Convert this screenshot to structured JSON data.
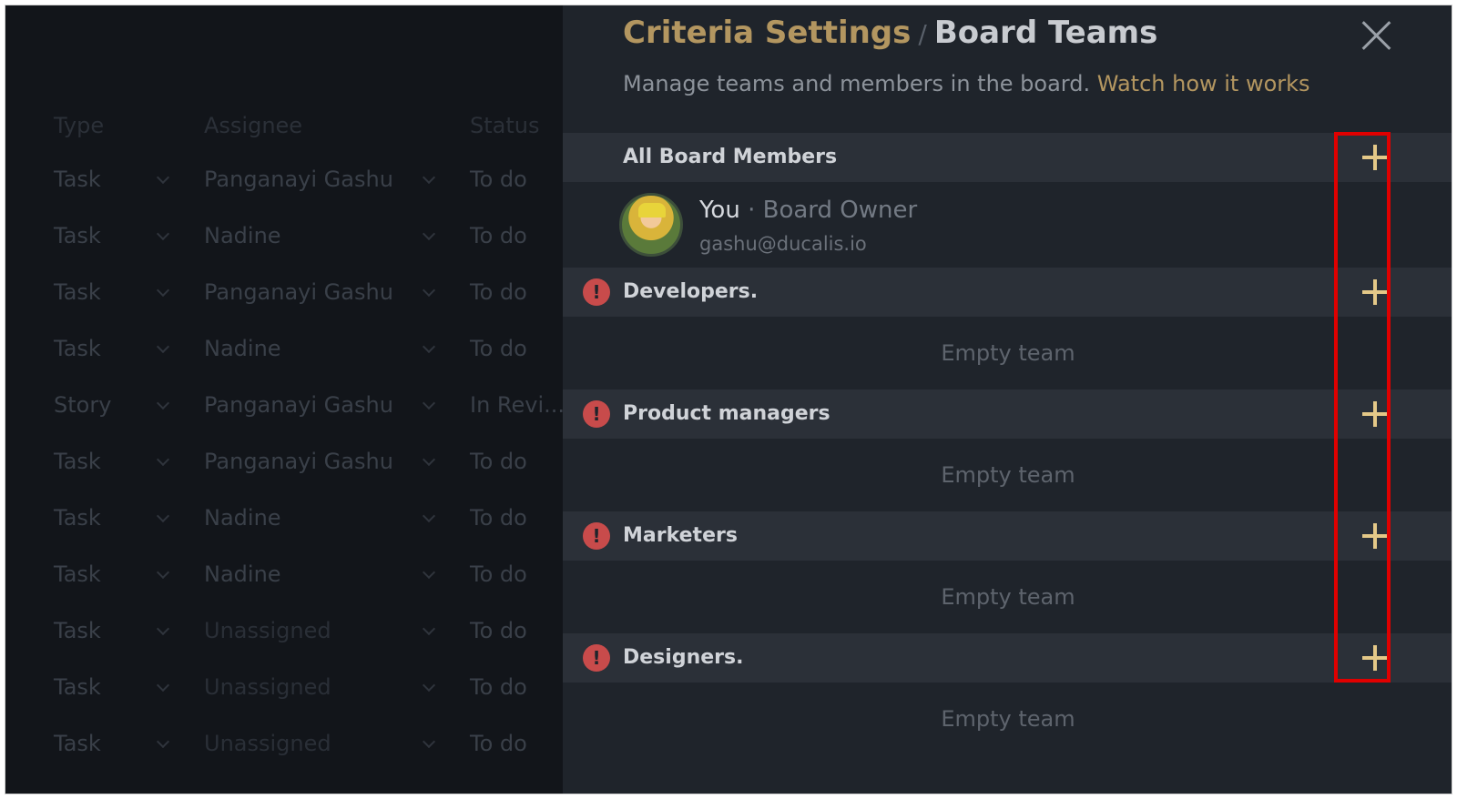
{
  "table": {
    "headers": [
      "Type",
      "Assignee",
      "Status"
    ],
    "rows": [
      {
        "type": "Task",
        "assignee": "Panganayi Gashu",
        "status": "To do"
      },
      {
        "type": "Task",
        "assignee": "Nadine",
        "status": "To do"
      },
      {
        "type": "Task",
        "assignee": "Panganayi Gashu",
        "status": "To do"
      },
      {
        "type": "Task",
        "assignee": "Nadine",
        "status": "To do"
      },
      {
        "type": "Story",
        "assignee": "Panganayi Gashu",
        "status": "In Revi..."
      },
      {
        "type": "Task",
        "assignee": "Panganayi Gashu",
        "status": "To do"
      },
      {
        "type": "Task",
        "assignee": "Nadine",
        "status": "To do"
      },
      {
        "type": "Task",
        "assignee": "Nadine",
        "status": "To do"
      },
      {
        "type": "Task",
        "assignee": "Unassigned",
        "status": "To do"
      },
      {
        "type": "Task",
        "assignee": "Unassigned",
        "status": "To do"
      },
      {
        "type": "Task",
        "assignee": "Unassigned",
        "status": "To do"
      }
    ]
  },
  "panel": {
    "breadcrumb": {
      "parent": "Criteria Settings",
      "separator": "/",
      "current": "Board Teams"
    },
    "subtitle": "Manage teams and members in the board.",
    "link": "Watch how it works",
    "all_members": {
      "title": "All Board Members",
      "member": {
        "name": "You",
        "role": "· Board Owner",
        "email": "gashu@ducalis.io"
      }
    },
    "teams": [
      {
        "name": "Developers.",
        "empty_label": "Empty team"
      },
      {
        "name": "Product managers",
        "empty_label": "Empty team"
      },
      {
        "name": "Marketers",
        "empty_label": "Empty team"
      },
      {
        "name": "Designers.",
        "empty_label": "Empty team"
      }
    ],
    "alert_glyph": "!"
  },
  "colors": {
    "accent": "#b39660",
    "plus": "#e4c888",
    "alert": "#c84b4b",
    "highlight": "#e00000"
  }
}
